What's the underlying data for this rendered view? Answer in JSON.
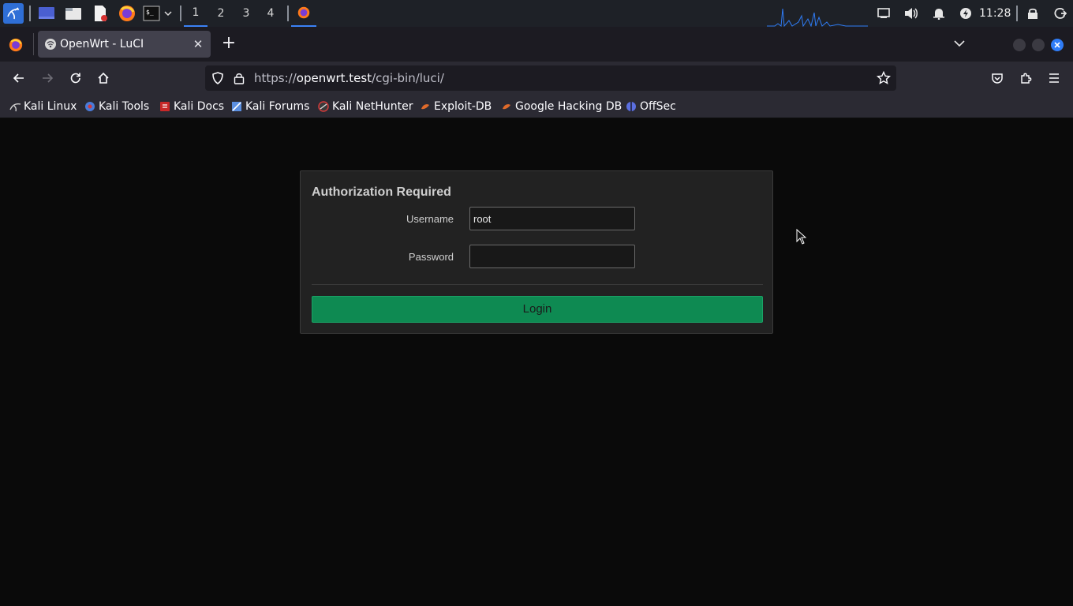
{
  "taskbar": {
    "workspaces": [
      "1",
      "2",
      "3",
      "4"
    ],
    "active_workspace": "1",
    "clock": "11:28",
    "icons": [
      "kali-menu-icon",
      "show-desktop-icon",
      "file-manager-icon",
      "text-editor-icon",
      "firefox-icon",
      "terminal-icon",
      "dropdown-icon"
    ],
    "tray_icons": [
      "display-icon",
      "volume-icon",
      "notifications-icon",
      "power-icon",
      "lock-icon",
      "logout-icon"
    ],
    "accent": "#3b82f6"
  },
  "browser": {
    "tab": {
      "title": "OpenWrt - LuCI",
      "close_glyph": "✕"
    },
    "new_tab_glyph": "+",
    "url": {
      "prefix": "https://",
      "host": "openwrt.test",
      "path": "/cgi-bin/luci/"
    },
    "bookmarks": [
      {
        "label": "Kali Linux",
        "color": "#cccccc"
      },
      {
        "label": "Kali Tools",
        "color": "#4a7bd9"
      },
      {
        "label": "Kali Docs",
        "color": "#d33a3a"
      },
      {
        "label": "Kali Forums",
        "color": "#5b8fe0"
      },
      {
        "label": "Kali NetHunter",
        "color": "#d33a3a"
      },
      {
        "label": "Exploit-DB",
        "color": "#e06a2a"
      },
      {
        "label": "Google Hacking DB",
        "color": "#e06a2a"
      },
      {
        "label": "OffSec",
        "color": "#5b6fe0"
      }
    ]
  },
  "login": {
    "heading": "Authorization Required",
    "username_label": "Username",
    "username_value": "root",
    "password_label": "Password",
    "password_value": "",
    "button_label": "Login",
    "button_color": "#0e8a52"
  }
}
